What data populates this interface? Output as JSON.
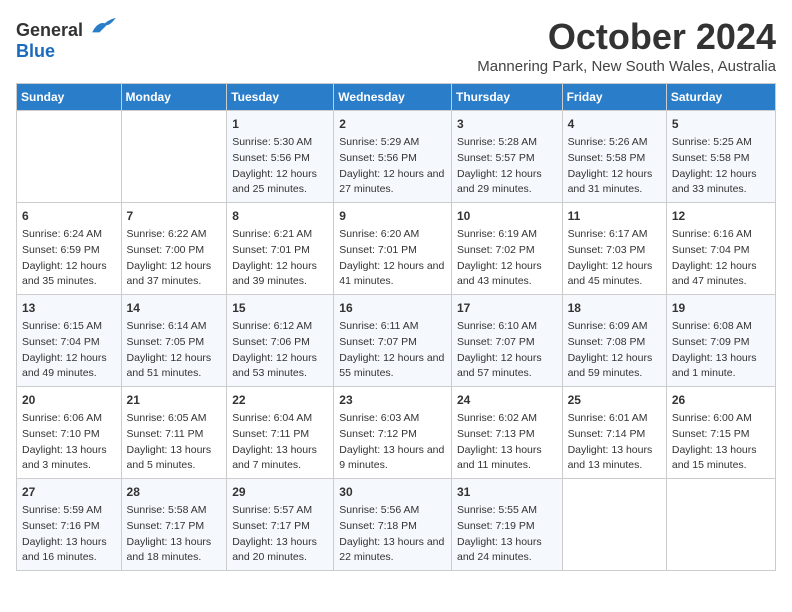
{
  "logo": {
    "general": "General",
    "blue": "Blue"
  },
  "title": "October 2024",
  "subtitle": "Mannering Park, New South Wales, Australia",
  "days_of_week": [
    "Sunday",
    "Monday",
    "Tuesday",
    "Wednesday",
    "Thursday",
    "Friday",
    "Saturday"
  ],
  "weeks": [
    [
      {
        "day": "",
        "sunrise": "",
        "sunset": "",
        "daylight": ""
      },
      {
        "day": "",
        "sunrise": "",
        "sunset": "",
        "daylight": ""
      },
      {
        "day": "1",
        "sunrise": "Sunrise: 5:30 AM",
        "sunset": "Sunset: 5:56 PM",
        "daylight": "Daylight: 12 hours and 25 minutes."
      },
      {
        "day": "2",
        "sunrise": "Sunrise: 5:29 AM",
        "sunset": "Sunset: 5:56 PM",
        "daylight": "Daylight: 12 hours and 27 minutes."
      },
      {
        "day": "3",
        "sunrise": "Sunrise: 5:28 AM",
        "sunset": "Sunset: 5:57 PM",
        "daylight": "Daylight: 12 hours and 29 minutes."
      },
      {
        "day": "4",
        "sunrise": "Sunrise: 5:26 AM",
        "sunset": "Sunset: 5:58 PM",
        "daylight": "Daylight: 12 hours and 31 minutes."
      },
      {
        "day": "5",
        "sunrise": "Sunrise: 5:25 AM",
        "sunset": "Sunset: 5:58 PM",
        "daylight": "Daylight: 12 hours and 33 minutes."
      }
    ],
    [
      {
        "day": "6",
        "sunrise": "Sunrise: 6:24 AM",
        "sunset": "Sunset: 6:59 PM",
        "daylight": "Daylight: 12 hours and 35 minutes."
      },
      {
        "day": "7",
        "sunrise": "Sunrise: 6:22 AM",
        "sunset": "Sunset: 7:00 PM",
        "daylight": "Daylight: 12 hours and 37 minutes."
      },
      {
        "day": "8",
        "sunrise": "Sunrise: 6:21 AM",
        "sunset": "Sunset: 7:01 PM",
        "daylight": "Daylight: 12 hours and 39 minutes."
      },
      {
        "day": "9",
        "sunrise": "Sunrise: 6:20 AM",
        "sunset": "Sunset: 7:01 PM",
        "daylight": "Daylight: 12 hours and 41 minutes."
      },
      {
        "day": "10",
        "sunrise": "Sunrise: 6:19 AM",
        "sunset": "Sunset: 7:02 PM",
        "daylight": "Daylight: 12 hours and 43 minutes."
      },
      {
        "day": "11",
        "sunrise": "Sunrise: 6:17 AM",
        "sunset": "Sunset: 7:03 PM",
        "daylight": "Daylight: 12 hours and 45 minutes."
      },
      {
        "day": "12",
        "sunrise": "Sunrise: 6:16 AM",
        "sunset": "Sunset: 7:04 PM",
        "daylight": "Daylight: 12 hours and 47 minutes."
      }
    ],
    [
      {
        "day": "13",
        "sunrise": "Sunrise: 6:15 AM",
        "sunset": "Sunset: 7:04 PM",
        "daylight": "Daylight: 12 hours and 49 minutes."
      },
      {
        "day": "14",
        "sunrise": "Sunrise: 6:14 AM",
        "sunset": "Sunset: 7:05 PM",
        "daylight": "Daylight: 12 hours and 51 minutes."
      },
      {
        "day": "15",
        "sunrise": "Sunrise: 6:12 AM",
        "sunset": "Sunset: 7:06 PM",
        "daylight": "Daylight: 12 hours and 53 minutes."
      },
      {
        "day": "16",
        "sunrise": "Sunrise: 6:11 AM",
        "sunset": "Sunset: 7:07 PM",
        "daylight": "Daylight: 12 hours and 55 minutes."
      },
      {
        "day": "17",
        "sunrise": "Sunrise: 6:10 AM",
        "sunset": "Sunset: 7:07 PM",
        "daylight": "Daylight: 12 hours and 57 minutes."
      },
      {
        "day": "18",
        "sunrise": "Sunrise: 6:09 AM",
        "sunset": "Sunset: 7:08 PM",
        "daylight": "Daylight: 12 hours and 59 minutes."
      },
      {
        "day": "19",
        "sunrise": "Sunrise: 6:08 AM",
        "sunset": "Sunset: 7:09 PM",
        "daylight": "Daylight: 13 hours and 1 minute."
      }
    ],
    [
      {
        "day": "20",
        "sunrise": "Sunrise: 6:06 AM",
        "sunset": "Sunset: 7:10 PM",
        "daylight": "Daylight: 13 hours and 3 minutes."
      },
      {
        "day": "21",
        "sunrise": "Sunrise: 6:05 AM",
        "sunset": "Sunset: 7:11 PM",
        "daylight": "Daylight: 13 hours and 5 minutes."
      },
      {
        "day": "22",
        "sunrise": "Sunrise: 6:04 AM",
        "sunset": "Sunset: 7:11 PM",
        "daylight": "Daylight: 13 hours and 7 minutes."
      },
      {
        "day": "23",
        "sunrise": "Sunrise: 6:03 AM",
        "sunset": "Sunset: 7:12 PM",
        "daylight": "Daylight: 13 hours and 9 minutes."
      },
      {
        "day": "24",
        "sunrise": "Sunrise: 6:02 AM",
        "sunset": "Sunset: 7:13 PM",
        "daylight": "Daylight: 13 hours and 11 minutes."
      },
      {
        "day": "25",
        "sunrise": "Sunrise: 6:01 AM",
        "sunset": "Sunset: 7:14 PM",
        "daylight": "Daylight: 13 hours and 13 minutes."
      },
      {
        "day": "26",
        "sunrise": "Sunrise: 6:00 AM",
        "sunset": "Sunset: 7:15 PM",
        "daylight": "Daylight: 13 hours and 15 minutes."
      }
    ],
    [
      {
        "day": "27",
        "sunrise": "Sunrise: 5:59 AM",
        "sunset": "Sunset: 7:16 PM",
        "daylight": "Daylight: 13 hours and 16 minutes."
      },
      {
        "day": "28",
        "sunrise": "Sunrise: 5:58 AM",
        "sunset": "Sunset: 7:17 PM",
        "daylight": "Daylight: 13 hours and 18 minutes."
      },
      {
        "day": "29",
        "sunrise": "Sunrise: 5:57 AM",
        "sunset": "Sunset: 7:17 PM",
        "daylight": "Daylight: 13 hours and 20 minutes."
      },
      {
        "day": "30",
        "sunrise": "Sunrise: 5:56 AM",
        "sunset": "Sunset: 7:18 PM",
        "daylight": "Daylight: 13 hours and 22 minutes."
      },
      {
        "day": "31",
        "sunrise": "Sunrise: 5:55 AM",
        "sunset": "Sunset: 7:19 PM",
        "daylight": "Daylight: 13 hours and 24 minutes."
      },
      {
        "day": "",
        "sunrise": "",
        "sunset": "",
        "daylight": ""
      },
      {
        "day": "",
        "sunrise": "",
        "sunset": "",
        "daylight": ""
      }
    ]
  ]
}
